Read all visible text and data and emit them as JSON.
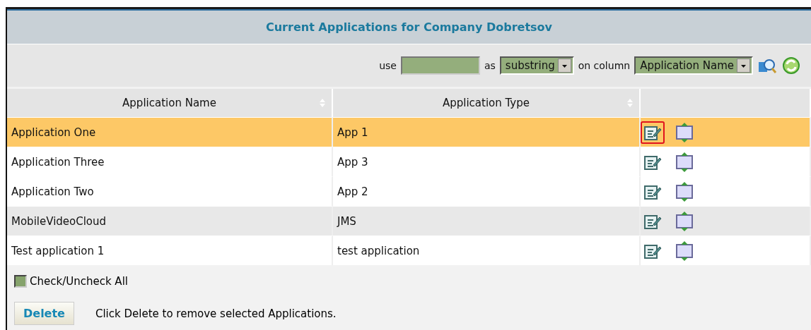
{
  "title": "Current Applications for Company Dobretsov",
  "filter": {
    "use_label": "use",
    "as_label": "as",
    "match": "substring",
    "column_label": "on column",
    "column": "Application Name"
  },
  "table": {
    "columns": [
      "Application Name",
      "Application Type"
    ],
    "rows": [
      {
        "name": "Application One",
        "type": "App 1",
        "selected": true,
        "shaded": false,
        "edit_outlined": true
      },
      {
        "name": "Application Three",
        "type": "App 3",
        "selected": false,
        "shaded": false,
        "edit_outlined": false
      },
      {
        "name": "Application Two",
        "type": "App 2",
        "selected": false,
        "shaded": false,
        "edit_outlined": false
      },
      {
        "name": "MobileVideoCloud",
        "type": "JMS",
        "selected": false,
        "shaded": true,
        "edit_outlined": false
      },
      {
        "name": "Test application 1",
        "type": "test application",
        "selected": false,
        "shaded": false,
        "edit_outlined": false
      }
    ]
  },
  "check_all": {
    "label": "Check/Uncheck All",
    "checked": false
  },
  "delete": {
    "label": "Delete",
    "hint": "Click Delete to remove selected Applications."
  }
}
